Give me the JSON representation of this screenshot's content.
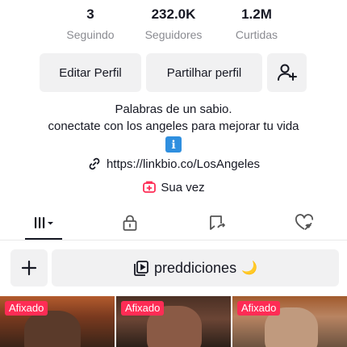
{
  "stats": [
    {
      "value": "3",
      "label": "Seguindo"
    },
    {
      "value": "232.0K",
      "label": "Seguidores"
    },
    {
      "value": "1.2M",
      "label": "Curtidas"
    }
  ],
  "buttons": {
    "edit_profile": "Editar Perfil",
    "share_profile": "Partilhar perfil",
    "add_friend_icon": "person-plus-icon"
  },
  "bio": {
    "line1": "Palabras de un sabio.",
    "line2": "conectate con los angeles para mejorar tu vida",
    "emoji": "ℹ"
  },
  "link": {
    "icon": "link-icon",
    "url": "https://linkbio.co/LosAngeles"
  },
  "your_turn": {
    "icon": "add-post-icon",
    "label": "Sua vez",
    "accent": "#fe2c55"
  },
  "tabs": [
    {
      "name": "videos-grid",
      "icon": "grid-bars-icon",
      "active": true
    },
    {
      "name": "private",
      "icon": "lock-icon",
      "active": false
    },
    {
      "name": "reposts",
      "icon": "repost-icon",
      "active": false
    },
    {
      "name": "liked",
      "icon": "heart-hidden-icon",
      "active": false
    }
  ],
  "playlist": {
    "add_icon": "plus-icon",
    "icon": "playlist-icon",
    "label": "preddiciones",
    "emoji": "🌙"
  },
  "videos": [
    {
      "badge": "Afixado"
    },
    {
      "badge": "Afixado"
    },
    {
      "badge": "Afixado"
    }
  ],
  "colors": {
    "accent": "#fe2c55",
    "button_bg": "#f1f1f2",
    "text_secondary": "#8a8b91"
  }
}
